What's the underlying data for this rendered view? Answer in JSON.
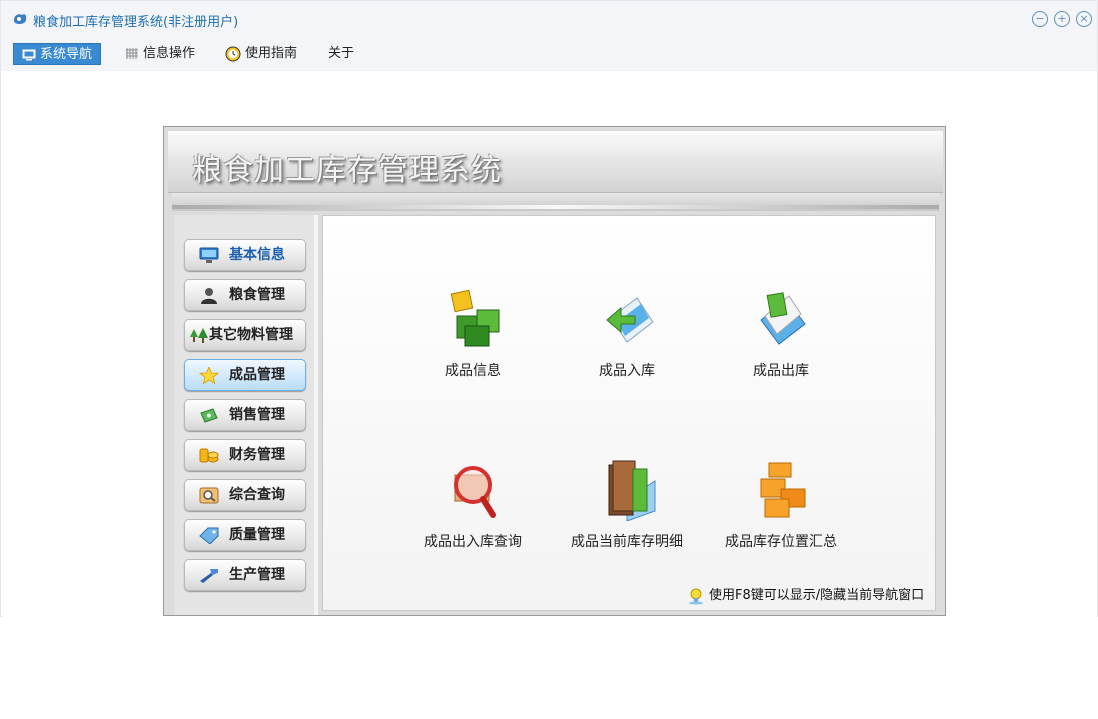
{
  "window": {
    "title": "粮食加工库存管理系统(非注册用户)"
  },
  "menubar": {
    "items": [
      {
        "label": "系统导航",
        "icon": "monitor-icon",
        "active": true
      },
      {
        "label": "信息操作",
        "icon": "grid-icon",
        "active": false
      },
      {
        "label": "使用指南",
        "icon": "clock-icon",
        "active": false
      },
      {
        "label": "关于",
        "icon": "",
        "active": false
      }
    ]
  },
  "navigator": {
    "header_title": "粮食加工库存管理系统",
    "sidebar": [
      {
        "label": "基本信息",
        "icon": "monitor-icon"
      },
      {
        "label": "粮食管理",
        "icon": "user-icon"
      },
      {
        "label": "其它物料管理",
        "icon": "trees-icon"
      },
      {
        "label": "成品管理",
        "icon": "star-icon"
      },
      {
        "label": "销售管理",
        "icon": "money-icon"
      },
      {
        "label": "财务管理",
        "icon": "coins-icon"
      },
      {
        "label": "综合查询",
        "icon": "search-icon"
      },
      {
        "label": "质量管理",
        "icon": "tag-icon"
      },
      {
        "label": "生产管理",
        "icon": "tool-icon"
      }
    ],
    "tiles": [
      {
        "label": "成品信息",
        "icon": "cubes-icon"
      },
      {
        "label": "成品入库",
        "icon": "inbound-icon"
      },
      {
        "label": "成品出库",
        "icon": "outbound-icon"
      },
      {
        "label": "成品出入库查询",
        "icon": "magnifier-box-icon"
      },
      {
        "label": "成品当前库存明细",
        "icon": "books-icon"
      },
      {
        "label": "成品库存位置汇总",
        "icon": "boxes-icon"
      }
    ],
    "hint": "使用F8键可以显示/隐藏当前导航窗口"
  },
  "colors": {
    "accent": "#3a8ad3",
    "title_text": "#1f6fb2",
    "active_sidebar": "#b9dcf7"
  }
}
